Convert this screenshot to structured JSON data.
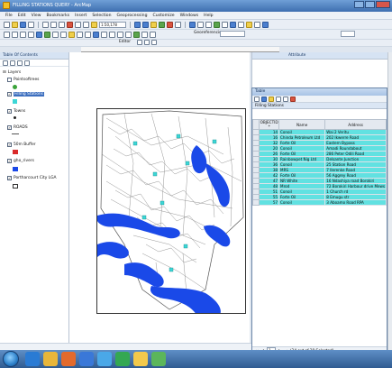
{
  "window": {
    "title": "FILLING STATIONS QUERY - ArcMap"
  },
  "menubar": {
    "items": [
      "File",
      "Edit",
      "View",
      "Bookmarks",
      "Insert",
      "Selection",
      "Geoprocessing",
      "Customize",
      "Windows",
      "Help"
    ]
  },
  "toolbar": {
    "scale": "1:50,178",
    "georef_label": "Georeferencing",
    "editor_label": "Editor"
  },
  "toc": {
    "title": "Table Of Contents",
    "layers_root": "Layers",
    "layers": [
      "Pointsoftrees",
      "Filling Stations",
      "Towns",
      "ROADS",
      "50m Buffer",
      "gho_rivers",
      "Portharcourt City LGA"
    ]
  },
  "right_pane": {
    "title": "Attribute"
  },
  "table_window": {
    "title": "Table",
    "table_name": "Filling Stations",
    "columns": [
      "OBJECTID *",
      "Name",
      "Address"
    ],
    "rows": [
      [
        "14",
        "Conoil",
        "Wai 2 Veritu"
      ],
      [
        "16",
        "Chinda Petroleum Ltd",
        "202 Ikwerre Road"
      ],
      [
        "32",
        "Forte Oil",
        "Eastern Bypass"
      ],
      [
        "20",
        "Conoil",
        "Amadi Roundabout"
      ],
      [
        "26",
        "Forte Oil",
        "286 Peter Odili Road"
      ],
      [
        "30",
        "Rainbowpet Nig Ltd",
        "Delsante Junction"
      ],
      [
        "36",
        "Conoil",
        "25 Station Road"
      ],
      [
        "38",
        "MRS",
        "7 Ilerenke Road"
      ],
      [
        "42",
        "Forte Oil",
        "56 Aggrey Road"
      ],
      [
        "47",
        "NR White",
        "16 Ndashiya road Borokiri"
      ],
      [
        "48",
        "Mrod",
        "72 Borokiri Harbour drive Mews"
      ],
      [
        "51",
        "Conoil",
        "1 Church rd"
      ],
      [
        "55",
        "Forte Oil",
        "8 Emugu str"
      ],
      [
        "57",
        "Conoil",
        "3 Aboamo Road RPA"
      ]
    ],
    "footer": "(24 out of 28 Selected)",
    "record_current": "1",
    "tab_label": "Filling Stations"
  },
  "colors": {
    "selection": "#61e1e1",
    "river": "#1a49e8",
    "station_point": "#3cd6d6"
  }
}
